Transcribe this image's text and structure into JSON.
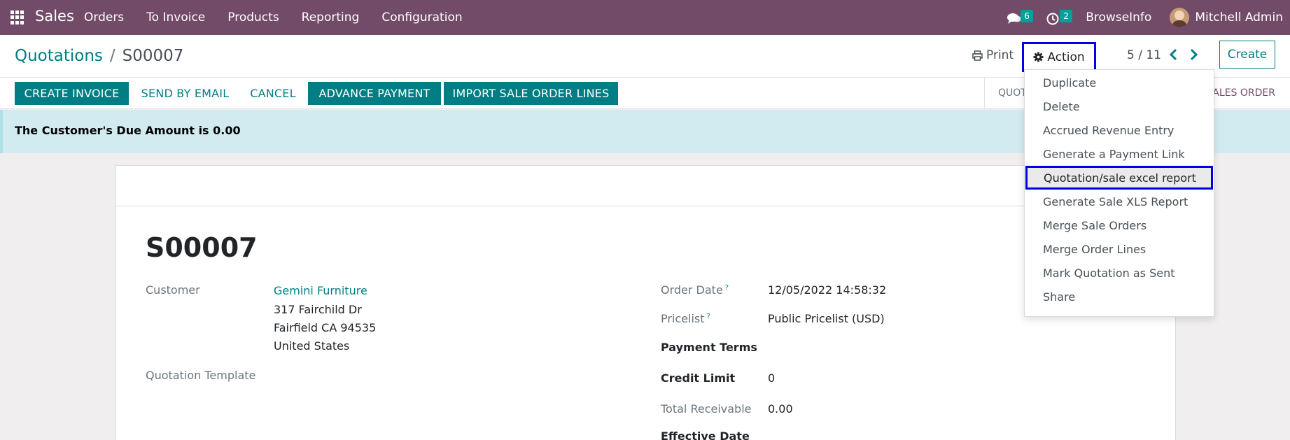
{
  "navbar": {
    "brand": "Sales",
    "menu": [
      "Orders",
      "To Invoice",
      "Products",
      "Reporting",
      "Configuration"
    ],
    "messages_count": "6",
    "activities_count": "2",
    "company": "BrowseInfo",
    "user": "Mitchell Admin"
  },
  "control": {
    "breadcrumb_parent": "Quotations",
    "breadcrumb_sep": "/",
    "breadcrumb_current": "S00007",
    "print_label": "Print",
    "action_label": "Action",
    "pager": "5 / 11",
    "create_label": "Create"
  },
  "statusbar": {
    "buttons": [
      "CREATE INVOICE",
      "SEND BY EMAIL",
      "CANCEL",
      "ADVANCE PAYMENT",
      "IMPORT SALE ORDER LINES"
    ],
    "stage_left": "QUOT",
    "stage_right": "ALES ORDER"
  },
  "alert": {
    "text": "The Customer's Due Amount is 0.00"
  },
  "form": {
    "title": "S00007",
    "customer_label": "Customer",
    "customer_name": "Gemini Furniture",
    "address_line1": "317 Fairchild Dr",
    "address_line2": "Fairfield CA 94535",
    "address_line3": "United States",
    "quotation_template_label": "Quotation Template",
    "order_date_label": "Order Date",
    "order_date": "12/05/2022 14:58:32",
    "pricelist_label": "Pricelist",
    "pricelist": "Public Pricelist (USD)",
    "payment_terms_label": "Payment Terms",
    "credit_limit_label": "Credit Limit",
    "credit_limit": "0",
    "total_receivable_label": "Total Receivable",
    "total_receivable": "0.00",
    "effective_date_label": "Effective Date",
    "help_mark": "?"
  },
  "action_menu": {
    "items": [
      "Duplicate",
      "Delete",
      "Accrued Revenue Entry",
      "Generate a Payment Link",
      "Quotation/sale excel report",
      "Generate Sale XLS Report",
      "Merge Sale Orders",
      "Merge Order Lines",
      "Mark Quotation as Sent",
      "Share"
    ],
    "highlighted_index": 4
  },
  "colors": {
    "navbar": "#714b67",
    "primary": "#017e84",
    "highlight_border": "#0000e6",
    "alert_bg": "#d2ebf0"
  }
}
